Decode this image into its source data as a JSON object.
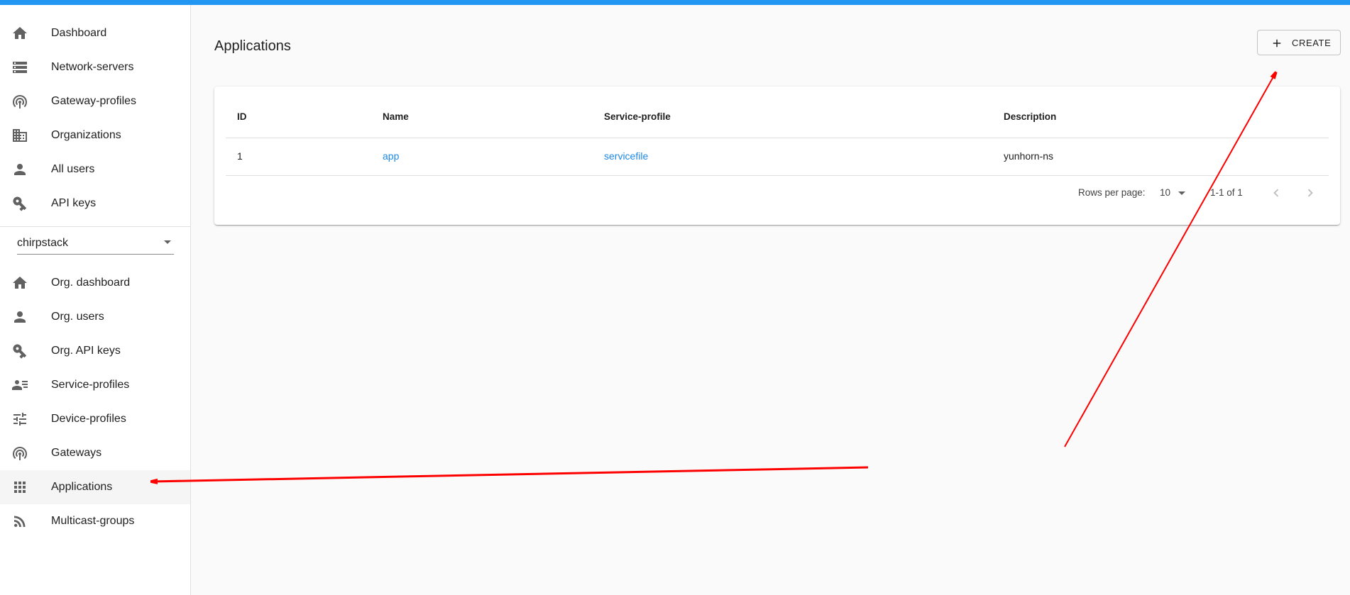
{
  "sidebar": {
    "admin_items": [
      {
        "label": "Dashboard",
        "icon": "home-icon"
      },
      {
        "label": "Network-servers",
        "icon": "server-icon"
      },
      {
        "label": "Gateway-profiles",
        "icon": "radio-tower-icon"
      },
      {
        "label": "Organizations",
        "icon": "building-icon"
      },
      {
        "label": "All users",
        "icon": "user-icon"
      },
      {
        "label": "API keys",
        "icon": "key-icon"
      }
    ],
    "org_selector": {
      "value": "chirpstack"
    },
    "org_items": [
      {
        "label": "Org. dashboard",
        "icon": "home-icon"
      },
      {
        "label": "Org. users",
        "icon": "user-icon"
      },
      {
        "label": "Org. API keys",
        "icon": "key-icon"
      },
      {
        "label": "Service-profiles",
        "icon": "account-details-icon"
      },
      {
        "label": "Device-profiles",
        "icon": "tune-icon"
      },
      {
        "label": "Gateways",
        "icon": "radio-tower-icon"
      },
      {
        "label": "Applications",
        "icon": "apps-grid-icon",
        "active": true
      },
      {
        "label": "Multicast-groups",
        "icon": "rss-icon"
      }
    ]
  },
  "main": {
    "title": "Applications",
    "create_label": "CREATE",
    "table": {
      "columns": [
        "ID",
        "Name",
        "Service-profile",
        "Description"
      ],
      "rows": [
        {
          "id": "1",
          "name": "app",
          "service_profile": "servicefile",
          "description": "yunhorn-ns"
        }
      ]
    },
    "pagination": {
      "rows_per_page_label": "Rows per page:",
      "rows_per_page_value": "10",
      "range": "1-1 of 1"
    }
  },
  "colors": {
    "accent_bar": "#2196f3",
    "link": "#1e88e5",
    "annotation_arrow": "#ff0000"
  }
}
